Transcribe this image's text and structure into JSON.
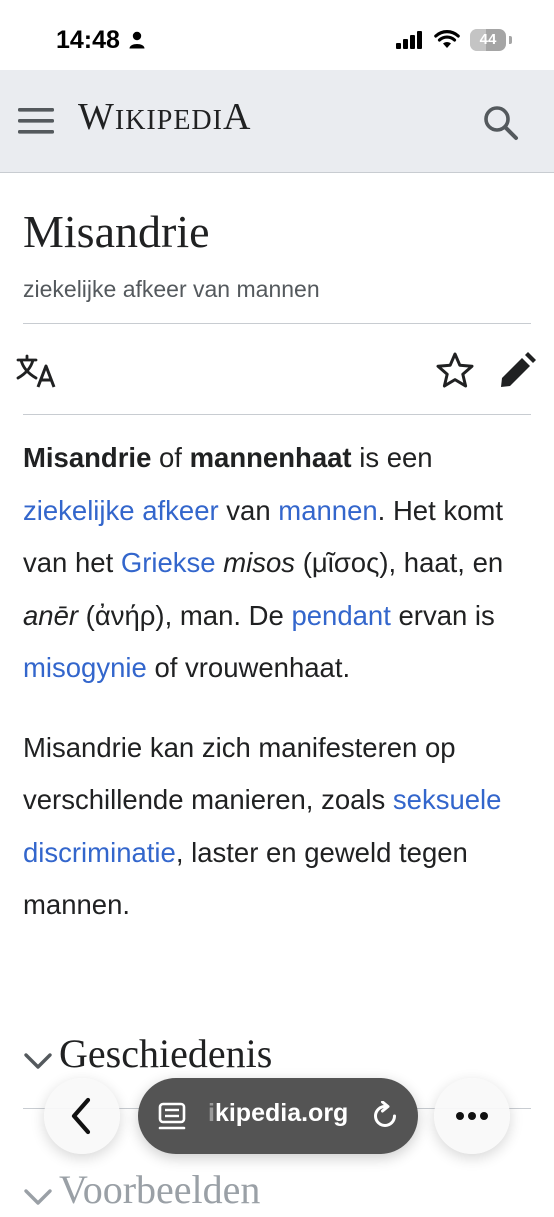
{
  "status_bar": {
    "time": "14:48",
    "battery": "44",
    "battery_level": 0.44
  },
  "header": {
    "logo_first": "W",
    "logo_middle": "IKIPEDI",
    "logo_last": "A"
  },
  "article": {
    "title": "Misandrie",
    "subtitle": "ziekelijke afkeer van mannen",
    "p1": {
      "b1": "Misandrie",
      "t1": " of ",
      "b2": "mannenhaat",
      "t2": " is een ",
      "l1": "ziekelijke afkeer",
      "t3": " van ",
      "l2": "mannen",
      "t4": ". Het komt van het ",
      "l3": "Griekse",
      "t5": " ",
      "i1": "misos",
      "t6": " (μῖσος), haat, en ",
      "i2": "anēr",
      "t7": " (ἀνήρ), man. De ",
      "l4": "pendant",
      "t8": " ervan is ",
      "l5": "misogynie",
      "t9": " of vrouwenhaat."
    },
    "p2": {
      "t1": "Misandrie kan zich manifesteren op verschillende manieren, zoals ",
      "l1": "seksuele discriminatie",
      "t2": ", laster en geweld tegen mannen."
    },
    "sections": [
      "Geschiedenis",
      "Voorbeelden"
    ]
  },
  "browser": {
    "url_faded": "i",
    "url_rest": "kipedia.org"
  },
  "colors": {
    "link": "#3366cc",
    "header_bg": "#eaecf0",
    "text": "#202122",
    "muted": "#54595d"
  }
}
